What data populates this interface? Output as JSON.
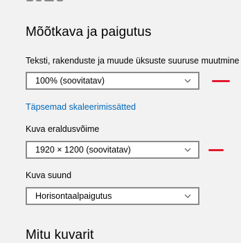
{
  "scale_layout": {
    "section_title": "Mõõtkava ja paigutus",
    "text_size_label": "Teksti, rakenduste ja muude üksuste suuruse muutmine",
    "text_size_value": "100% (soovitatav)",
    "advanced_link": "Täpsemad skaleerimissätted",
    "resolution_label": "Kuva eraldusvõime",
    "resolution_value": "1920 × 1200 (soovitatav)",
    "orientation_label": "Kuva suund",
    "orientation_value": "Horisontaalpaigutus"
  },
  "multiple_displays": {
    "section_title": "Mitu kuvarit"
  },
  "icons": {
    "dropdown": "chevron-down-icon"
  },
  "colors": {
    "link": "#0067b8",
    "annotation": "#e3182d",
    "background": "#f2f2f2"
  }
}
